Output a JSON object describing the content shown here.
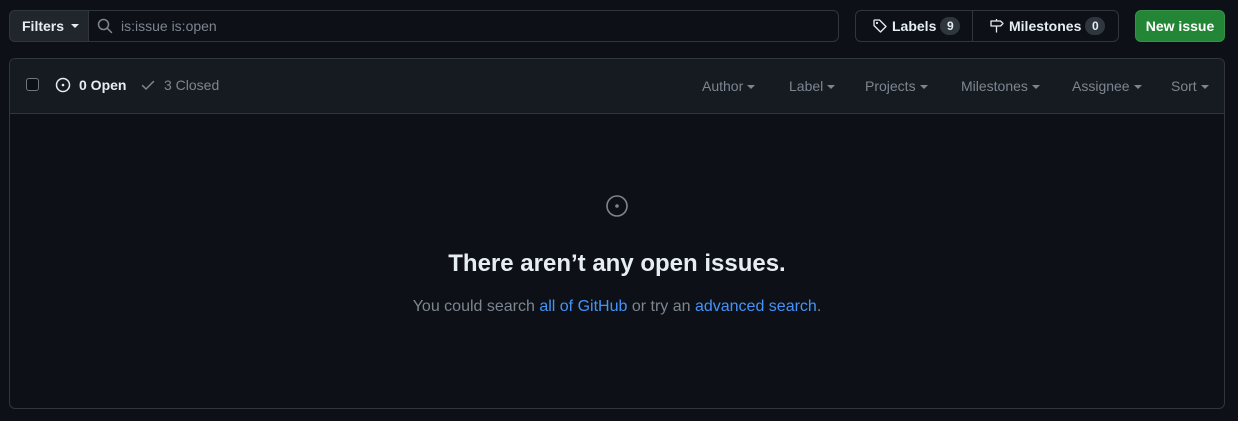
{
  "topbar": {
    "filters_label": "Filters",
    "search_placeholder": "is:issue is:open",
    "labels_label": "Labels",
    "labels_count": "9",
    "milestones_label": "Milestones",
    "milestones_count": "0",
    "new_issue_label": "New issue"
  },
  "header": {
    "open_label": "0 Open",
    "closed_label": "3 Closed",
    "filters": [
      "Author",
      "Label",
      "Projects",
      "Milestones",
      "Assignee",
      "Sort"
    ]
  },
  "blankslate": {
    "title": "There aren’t any open issues.",
    "text_prefix": "You could search ",
    "link1": "all of GitHub",
    "text_mid": " or try an ",
    "link2": "advanced search",
    "text_suffix": "."
  },
  "colors": {
    "background": "#0d1117",
    "header_bg": "#161b22",
    "border": "#30363d",
    "accent_green": "#238636",
    "link_blue": "#4493f8",
    "muted_text": "#7d8590"
  },
  "icons": {
    "search": "search-icon",
    "tag": "tag-icon",
    "milestone": "milestone-icon",
    "issue_open": "issue-opened-icon",
    "check": "check-icon"
  }
}
